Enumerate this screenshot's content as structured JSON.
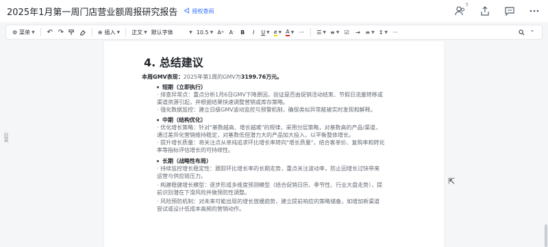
{
  "header": {
    "title": "2025年1月第一周门店营业额周报研究报告",
    "share_label": "授权查阅",
    "collab_count": "5"
  },
  "icons": {
    "collaborators": "people-icon",
    "share": "upload-icon",
    "comment": "comment-icon",
    "more": "more-icon"
  },
  "toolbar": {
    "menu": "菜单",
    "insert": "插入",
    "style": "正文",
    "font": "默认字体",
    "size": "10.5",
    "more": "···"
  },
  "side_tab": "目录",
  "doc": {
    "heading": "4. 总结建议",
    "summary_label": "本周GMV表现：",
    "summary_text": "2025年第1周的GMV为",
    "summary_value": "3199.76万元。",
    "sections": [
      {
        "title": "短期（立即执行）",
        "lines": [
          "· 排查异常点：重点分析1月6日GMV下降原因，验证是否由促销活动结束、节假日流量转移或",
          "  渠道资源引起，并根据结果快速调整营销或库存策略。",
          "· 强化数据监控：建立日级GMV波动监控与预警机制，确保类似异常能被实时发现和解释。"
        ]
      },
      {
        "title": "中期（结构优化）",
        "lines": [
          "· 优化增长策略：针对\"基数越高、增长越难\"的规律，采用分层策略，对基数高的产品/渠道，",
          "  通过差异化营销维持稳定，对基数低但潜力大的产品加大投入，以平衡整体增长。",
          "· 提升增长质量：将关注点从单纯追求环比增长率转向\"增长质量\"，结合客单价、复购率和转化",
          "  率等指标评估增长的可持续性。"
        ]
      },
      {
        "title": "长期（战略性布局）",
        "lines": [
          "· 持续监控增长稳定性：跟踪环比增长率的长期走势，重点关注波动率，防止因增长过快带来",
          "  运营与供应链压力。",
          "· 构建稳健增长模型：逐步形成多维度预测模型（结合促销日历、季节性、行业大盘走势），提",
          "  前识别潜在下滑风险并做预防性调整。",
          "· 风险预防机制：对未来可能出现的增长放缓趋势，建立提前响应的策略储备，如增加新渠道",
          "  尝试或设计低成本高频的营销动作。"
        ]
      }
    ]
  }
}
